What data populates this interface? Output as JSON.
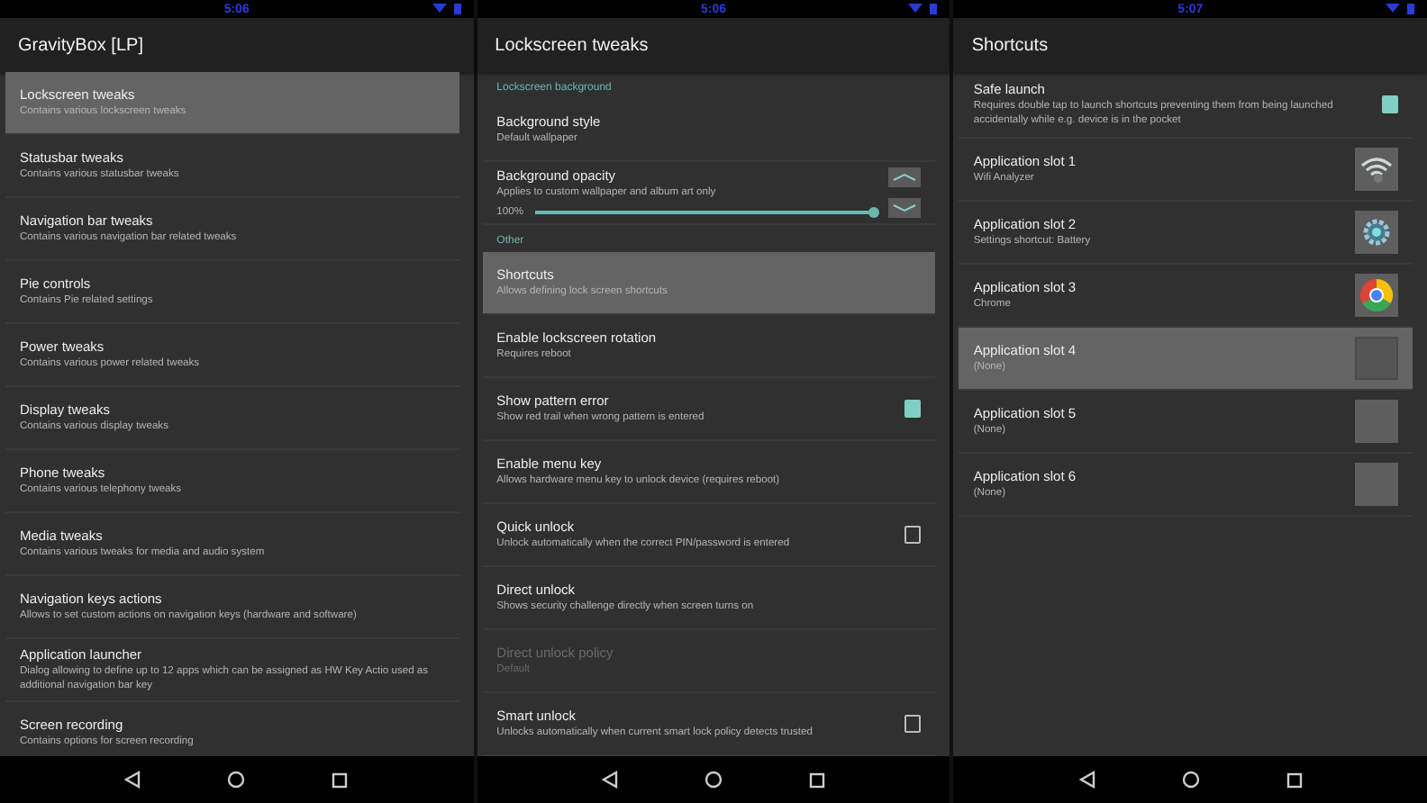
{
  "panels": [
    {
      "status_time": "5:06",
      "title": "GravityBox [LP]",
      "items": [
        {
          "kind": "pref",
          "title": "Lockscreen tweaks",
          "summary": "Contains various lockscreen tweaks",
          "selected": true
        },
        {
          "kind": "pref",
          "title": "Statusbar tweaks",
          "summary": "Contains various statusbar tweaks",
          "selected": false
        },
        {
          "kind": "pref",
          "title": "Navigation bar tweaks",
          "summary": "Contains various navigation bar related tweaks",
          "selected": false
        },
        {
          "kind": "pref",
          "title": "Pie controls",
          "summary": "Contains Pie related settings",
          "selected": false
        },
        {
          "kind": "pref",
          "title": "Power tweaks",
          "summary": "Contains various power related tweaks",
          "selected": false
        },
        {
          "kind": "pref",
          "title": "Display tweaks",
          "summary": "Contains various display tweaks",
          "selected": false
        },
        {
          "kind": "pref",
          "title": "Phone tweaks",
          "summary": "Contains various telephony tweaks",
          "selected": false
        },
        {
          "kind": "pref",
          "title": "Media tweaks",
          "summary": "Contains various tweaks for media and audio system",
          "selected": false
        },
        {
          "kind": "pref",
          "title": "Navigation keys actions",
          "summary": "Allows to set custom actions on navigation keys (hardware and software)",
          "selected": false
        },
        {
          "kind": "pref",
          "title": "Application launcher",
          "summary": "Dialog allowing to define up to 12 apps which can be assigned as HW Key Actio used as additional navigation bar key",
          "selected": false
        },
        {
          "kind": "pref",
          "title": "Screen recording",
          "summary": "Contains options for screen recording",
          "selected": false
        }
      ]
    },
    {
      "status_time": "5:06",
      "title": "Lockscreen tweaks",
      "items": [
        {
          "kind": "category",
          "title": "Lockscreen background"
        },
        {
          "kind": "pref",
          "title": "Background style",
          "summary": "Default wallpaper",
          "selected": false
        },
        {
          "kind": "slider",
          "title": "Background opacity",
          "summary": "Applies to custom wallpaper and album art only",
          "reading": "100%",
          "level": 1.0
        },
        {
          "kind": "category",
          "title": "Other"
        },
        {
          "kind": "pref",
          "title": "Shortcuts",
          "summary": "Allows defining lock screen shortcuts",
          "selected": true
        },
        {
          "kind": "pref",
          "title": "Enable lockscreen rotation",
          "summary": "Requires reboot",
          "selected": false
        },
        {
          "kind": "checkbox",
          "title": "Show pattern error",
          "summary": "Show red trail when wrong pattern is entered",
          "checked": true
        },
        {
          "kind": "pref",
          "title": "Enable menu key",
          "summary": "Allows hardware menu key to unlock device (requires reboot)",
          "selected": false
        },
        {
          "kind": "checkbox",
          "title": "Quick unlock",
          "summary": "Unlock automatically when the correct PIN/password is entered",
          "checked": false
        },
        {
          "kind": "pref",
          "title": "Direct unlock",
          "summary": "Shows security challenge directly when screen turns on",
          "selected": false
        },
        {
          "kind": "disabled",
          "title": "Direct unlock policy",
          "summary": "Default"
        },
        {
          "kind": "checkbox",
          "title": "Smart unlock",
          "summary": "Unlocks automatically when current smart lock policy detects trusted",
          "checked": false
        }
      ]
    },
    {
      "status_time": "5:07",
      "title": "Shortcuts",
      "items": [
        {
          "kind": "checkbox",
          "title": "Safe launch",
          "summary": "Requires double tap to launch shortcuts preventing them from being launched accidentally while e.g. device is in the pocket",
          "checked": true
        },
        {
          "kind": "wifi",
          "title": "Application slot 1",
          "summary": "Wifi Analyzer",
          "selected": false
        },
        {
          "kind": "gear",
          "title": "Application slot 2",
          "summary": "Settings shortcut: Battery",
          "selected": false
        },
        {
          "kind": "browser",
          "title": "Application slot 3",
          "summary": "Chrome",
          "selected": false
        },
        {
          "kind": "empty",
          "title": "Application slot 4",
          "summary": "(None)",
          "selected": true
        },
        {
          "kind": "empty",
          "title": "Application slot 5",
          "summary": "(None)",
          "selected": false
        },
        {
          "kind": "empty",
          "title": "Application slot 6",
          "summary": "(None)",
          "selected": false
        }
      ]
    }
  ]
}
